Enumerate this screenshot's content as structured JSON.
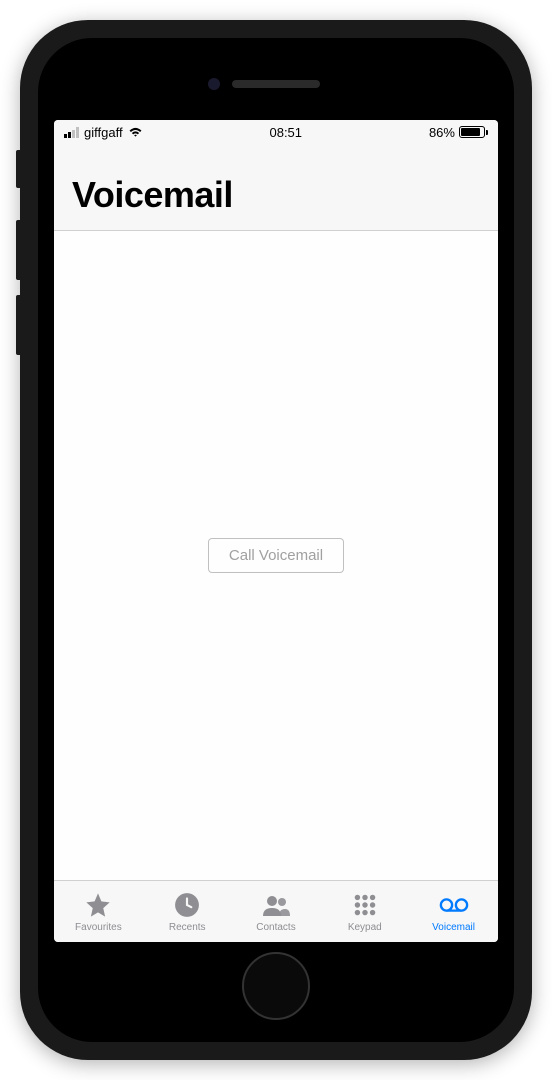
{
  "status_bar": {
    "carrier": "giffgaff",
    "time": "08:51",
    "battery_percent": "86%"
  },
  "header": {
    "title": "Voicemail"
  },
  "content": {
    "call_button_label": "Call Voicemail"
  },
  "tab_bar": {
    "tabs": [
      {
        "label": "Favourites",
        "icon": "star",
        "active": false
      },
      {
        "label": "Recents",
        "icon": "clock",
        "active": false
      },
      {
        "label": "Contacts",
        "icon": "contacts",
        "active": false
      },
      {
        "label": "Keypad",
        "icon": "keypad",
        "active": false
      },
      {
        "label": "Voicemail",
        "icon": "voicemail",
        "active": true
      }
    ]
  }
}
